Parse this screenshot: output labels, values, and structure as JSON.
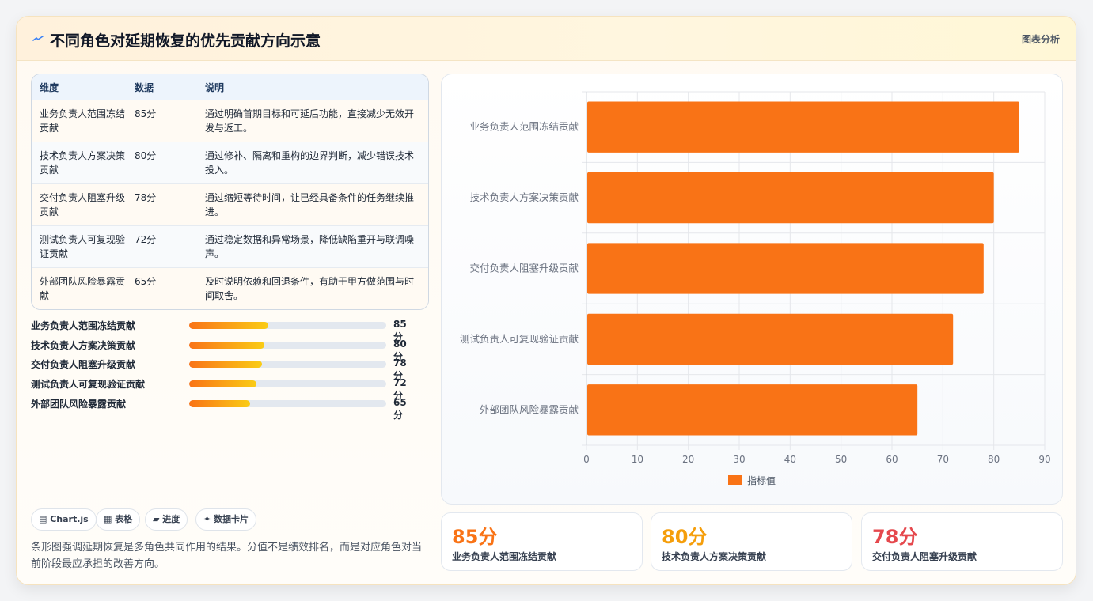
{
  "header": {
    "title": "不同角色对延期恢复的优先贡献方向示意",
    "tag": "图表分析"
  },
  "table": {
    "headers": [
      "维度",
      "数据",
      "说明"
    ],
    "rows": [
      {
        "dim": "业务负责人范围冻结贡献",
        "value": "85分",
        "desc": "通过明确首期目标和可延后功能，直接减少无效开发与返工。"
      },
      {
        "dim": "技术负责人方案决策贡献",
        "value": "80分",
        "desc": "通过修补、隔离和重构的边界判断，减少错误技术投入。"
      },
      {
        "dim": "交付负责人阻塞升级贡献",
        "value": "78分",
        "desc": "通过缩短等待时间，让已经具备条件的任务继续推进。"
      },
      {
        "dim": "测试负责人可复现验证贡献",
        "value": "72分",
        "desc": "通过稳定数据和异常场景，降低缺陷重开与联调噪声。"
      },
      {
        "dim": "外部团队风险暴露贡献",
        "value": "65分",
        "desc": "及时说明依赖和回退条件，有助于甲方做范围与时间取舍。"
      }
    ]
  },
  "progress": [
    {
      "label": "业务负责人范围冻结贡献",
      "value_text": "85分",
      "fill": 0.4
    },
    {
      "label": "技术负责人方案决策贡献",
      "value_text": "80分",
      "fill": 0.38
    },
    {
      "label": "交付负责人阻塞升级贡献",
      "value_text": "78分",
      "fill": 0.37
    },
    {
      "label": "测试负责人可复现验证贡献",
      "value_text": "72分",
      "fill": 0.34
    },
    {
      "label": "外部团队风险暴露贡献",
      "value_text": "65分",
      "fill": 0.31
    }
  ],
  "chips": [
    "▤ Chart.js",
    "▦ 表格",
    "▰ 进度",
    "✦ 数据卡片"
  ],
  "note": "条形图强调延期恢复是多角色共同作用的结果。分值不是绩效排名，而是对应角色对当前阶段最应承担的改善方向。",
  "kpis": [
    {
      "value": "85分",
      "label": "业务负责人范围冻结贡献",
      "color": "#f97316"
    },
    {
      "value": "80分",
      "label": "技术负责人方案决策贡献",
      "color": "#f59e0b"
    },
    {
      "value": "78分",
      "label": "交付负责人阻塞升级贡献",
      "color": "#e5484d"
    }
  ],
  "colors": {
    "bar": "#f97316",
    "accent_orange": "#f97316",
    "accent_amber": "#f59e0b",
    "accent_red": "#e5484d"
  },
  "chart_data": {
    "type": "bar",
    "orientation": "horizontal",
    "categories": [
      "业务负责人范围冻结贡献",
      "技术负责人方案决策贡献",
      "交付负责人阻塞升级贡献",
      "测试负责人可复现验证贡献",
      "外部团队风险暴露贡献"
    ],
    "series": [
      {
        "name": "指标值",
        "values": [
          85,
          80,
          78,
          72,
          65
        ]
      }
    ],
    "xlim": [
      0,
      90
    ],
    "xticks": [
      0,
      10,
      20,
      30,
      40,
      50,
      60,
      70,
      80,
      90
    ],
    "grid": true,
    "legend": "bottom"
  }
}
